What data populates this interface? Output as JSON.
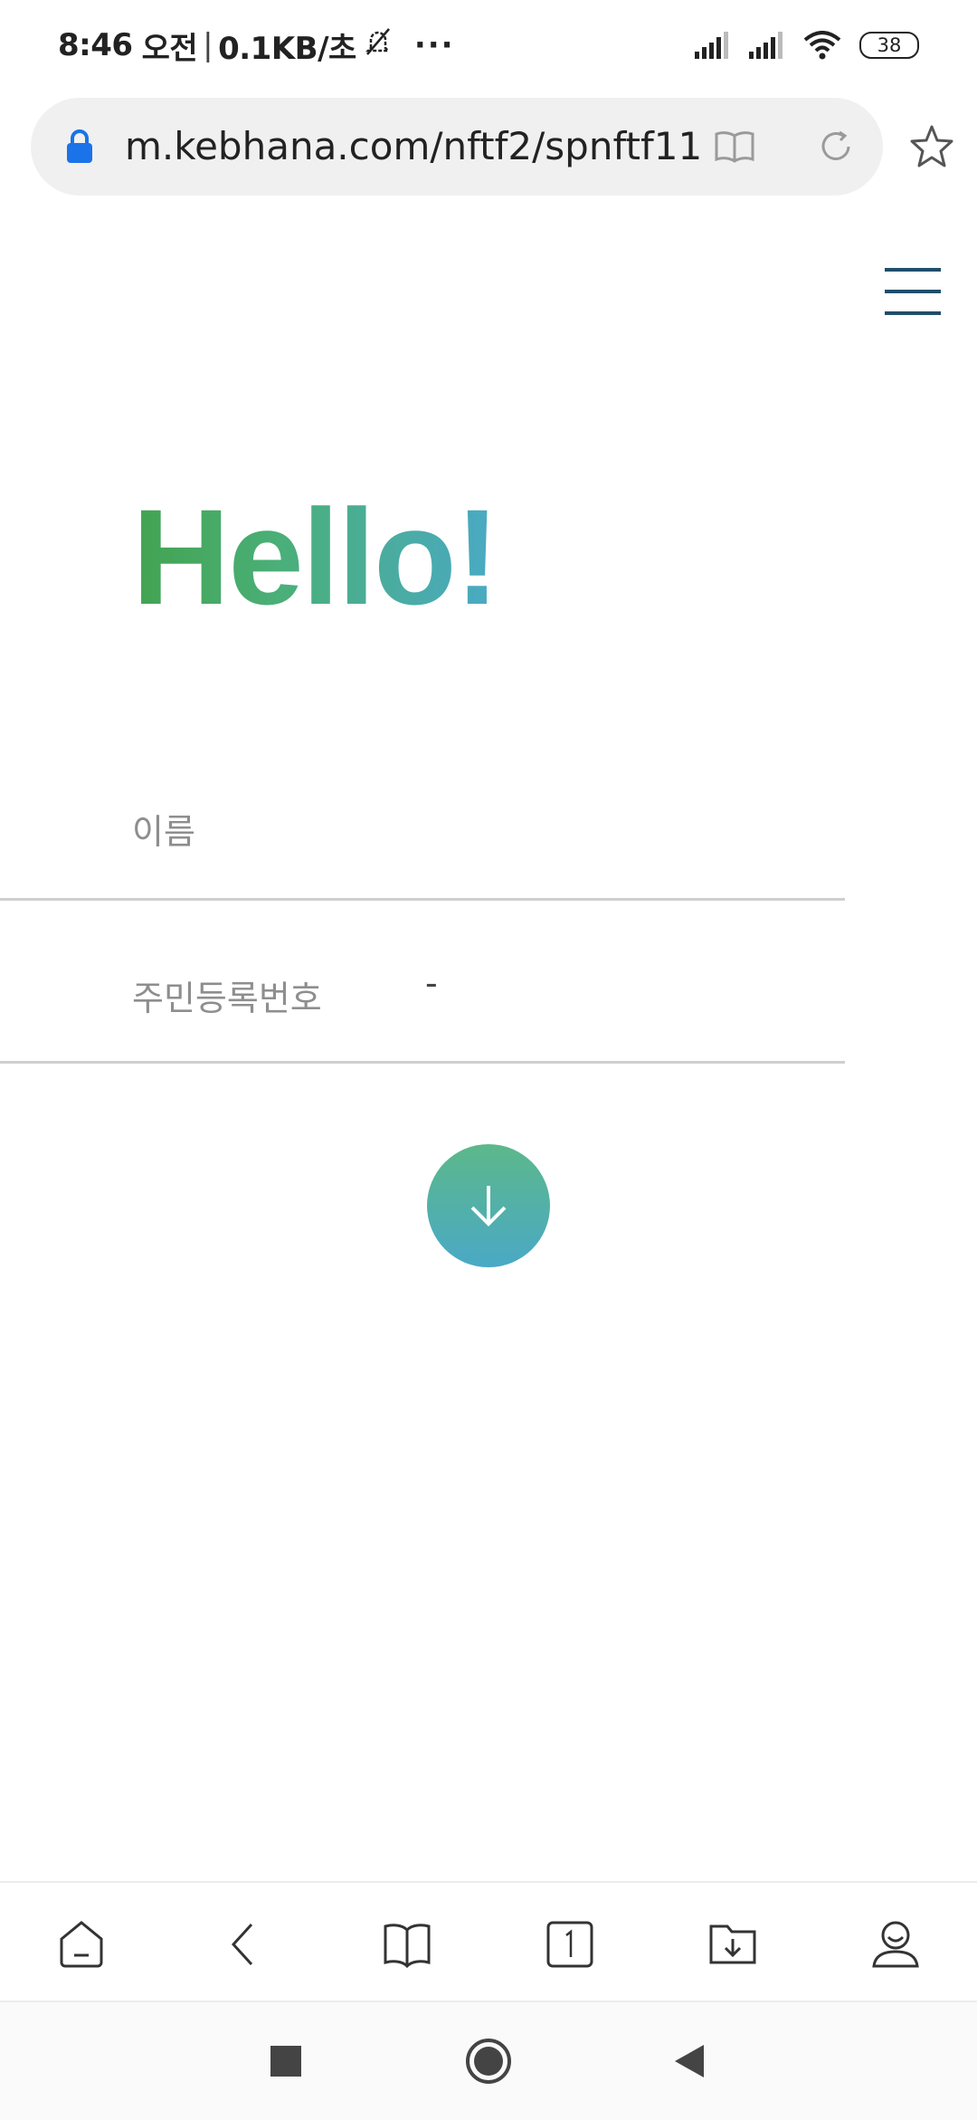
{
  "status_bar": {
    "time": "8:46",
    "ampm": "오전",
    "speed": "0.1KB/초",
    "more": "···",
    "battery": "38"
  },
  "address_bar": {
    "url": "m.kebhana.com/nftf2/spnftf11"
  },
  "page": {
    "headline": "Hello!",
    "name_label": "이름",
    "id_label": "주민등록번호",
    "id_separator": "-"
  },
  "colors": {
    "accent_green": "#43a350",
    "accent_blue": "#4aa9c6",
    "menu_color": "#1f4e6b"
  }
}
